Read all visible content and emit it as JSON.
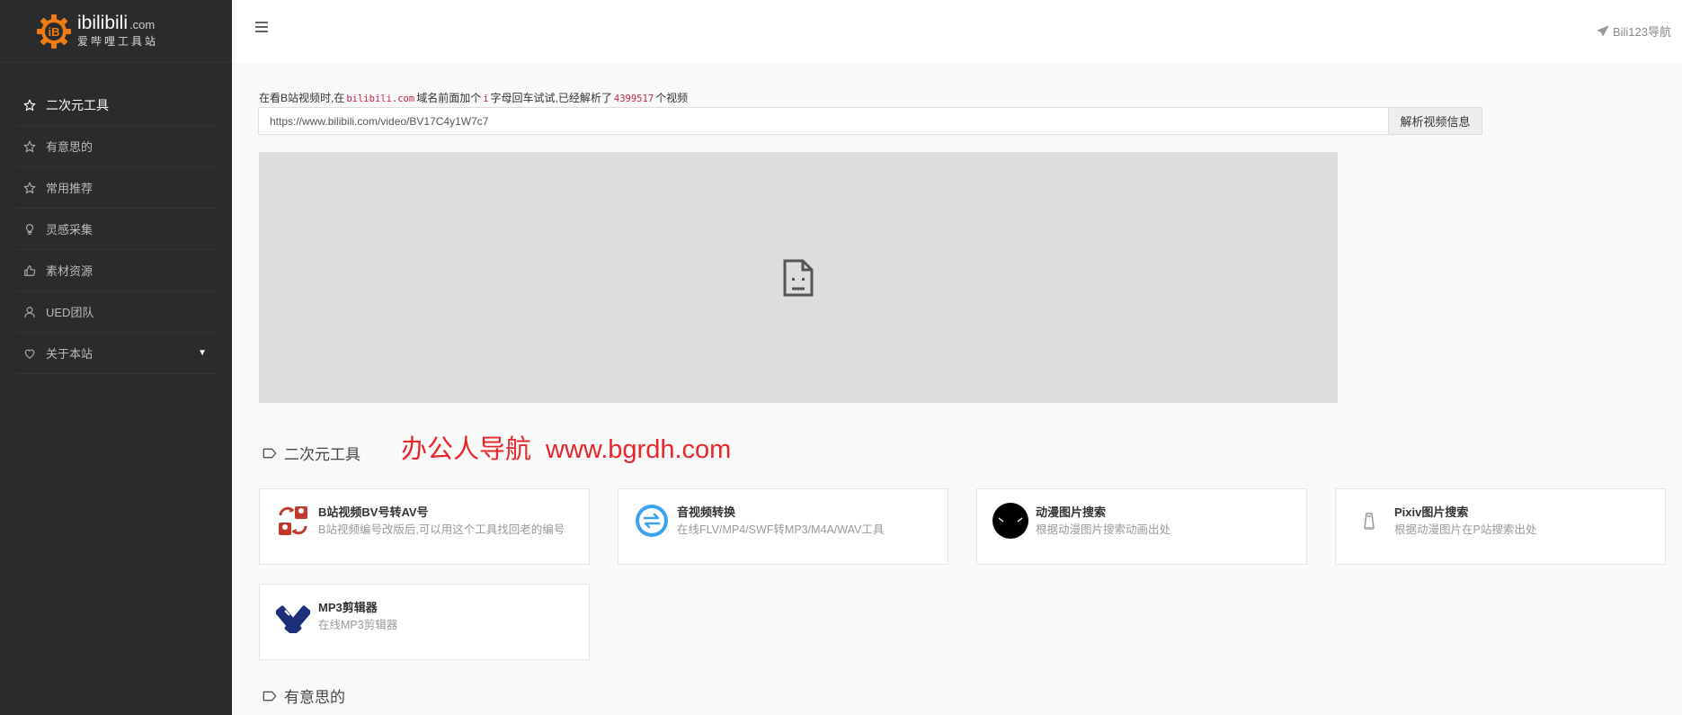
{
  "logo": {
    "main": "ibilibili",
    "domain": ".com",
    "subtitle": "爱哔哩工具站",
    "color": "#f07a13"
  },
  "sidebar": {
    "items": [
      {
        "label": "二次元工具",
        "icon": "star-icon",
        "active": true
      },
      {
        "label": "有意思的",
        "icon": "star-icon"
      },
      {
        "label": "常用推荐",
        "icon": "star-icon"
      },
      {
        "label": "灵感采集",
        "icon": "lightbulb-icon"
      },
      {
        "label": "素材资源",
        "icon": "thumbs-up-icon"
      },
      {
        "label": "UED团队",
        "icon": "user-icon"
      },
      {
        "label": "关于本站",
        "icon": "heart-icon",
        "caret": "▼"
      }
    ]
  },
  "header": {
    "menu_icon": "hamburger-icon",
    "nav_link": "Bili123导航",
    "nav_link_icon": "paper-plane-icon"
  },
  "notice": {
    "prefix": "在看B站视频时,在",
    "domain_code": "bilibili.com",
    "middle": "域名前面加个",
    "letter_code": "i",
    "suffix1": "字母回车试试,已经解析了",
    "count_code": "4399517",
    "suffix2": "个视频"
  },
  "url_input": {
    "value": "https://www.bilibili.com/video/BV17C4y1W7c7"
  },
  "parse_button": "解析视频信息",
  "player": {
    "icon": "broken-file-icon"
  },
  "watermark": {
    "cn": "办公人导航",
    "url": "www.bgrdh.com",
    "color": "#e8262a"
  },
  "sections": [
    {
      "title": "二次元工具",
      "icon": "tag-icon"
    },
    {
      "title": "有意思的",
      "icon": "tag-icon"
    }
  ],
  "cards": [
    {
      "title": "B站视频BV号转AV号",
      "desc": "B站视频编号改版后,可以用这个工具找回老的编号",
      "icon": "bv-av-convert-icon"
    },
    {
      "title": "音视频转换",
      "desc": "在线FLV/MP4/SWF转MP3/M4A/WAV工具",
      "icon": "convert-arrows-icon"
    },
    {
      "title": "动漫图片搜索",
      "desc": "根据动漫图片搜索动画出处",
      "icon": "anime-face-icon"
    },
    {
      "title": "Pixiv图片搜索",
      "desc": "根据动漫图片在P站搜索出处",
      "icon": "pixiv-figure-icon"
    },
    {
      "title": "MP3剪辑器",
      "desc": "在线MP3剪辑器",
      "icon": "mp3-cutter-icon"
    }
  ]
}
